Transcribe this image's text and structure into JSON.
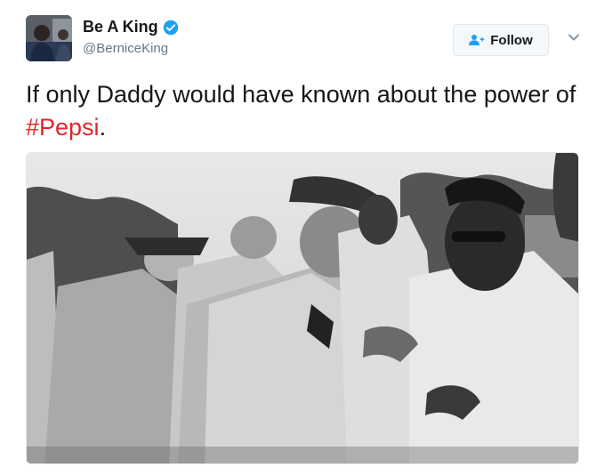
{
  "user": {
    "name": "Be A King",
    "handle": "@BerniceKing",
    "verified": true
  },
  "actions": {
    "follow_label": "Follow"
  },
  "tweet": {
    "text_before": "If only Daddy would have known about the power of ",
    "hashtag": "#Pepsi",
    "text_after": "."
  },
  "icons": {
    "verified": "verified-badge-icon",
    "follow": "add-person-icon",
    "more": "chevron-down-icon"
  },
  "colors": {
    "hashtag": "#e0252b",
    "verified": "#1da1f2",
    "follow_icon": "#1da1f2",
    "handle": "#657786",
    "text": "#14171a"
  }
}
